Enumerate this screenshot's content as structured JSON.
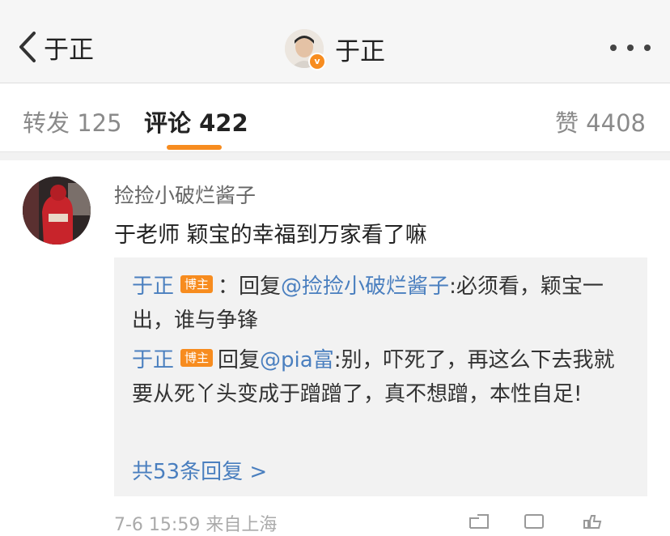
{
  "nav": {
    "back_label": "于正",
    "title": "于正",
    "verify_mark": "v"
  },
  "tabs": {
    "reposts": "转发 125",
    "comments": "评论 422",
    "likes": "赞 4408"
  },
  "comment": {
    "username": "捡捡小破烂酱子",
    "text": "于老师 颖宝的幸福到万家看了嘛",
    "replies": [
      {
        "user": "于正",
        "badge": "博主",
        "prefix": "：回复",
        "mention": "@捡捡小破烂酱子",
        "text": ":必须看，颖宝一出，谁与争锋"
      },
      {
        "user": "于正",
        "badge": "博主",
        "prefix": "回复",
        "mention": "@pia富",
        "text": ":别，吓死了，再这么下去我就要从死丫头变成于蹭蹭了，真不想蹭，本性自足!"
      }
    ],
    "more_replies": "共53条回复 >",
    "meta": "7-6 15:59 来自上海"
  },
  "colors": {
    "accent": "#f78c1f",
    "link": "#4a7fbf",
    "nav_bg": "#f6f6f6",
    "reply_bg": "#f2f2f2"
  },
  "icons": [
    "back-chevron-icon",
    "more-dots-icon",
    "share-icon",
    "comment-icon",
    "like-icon",
    "verified-icon"
  ]
}
